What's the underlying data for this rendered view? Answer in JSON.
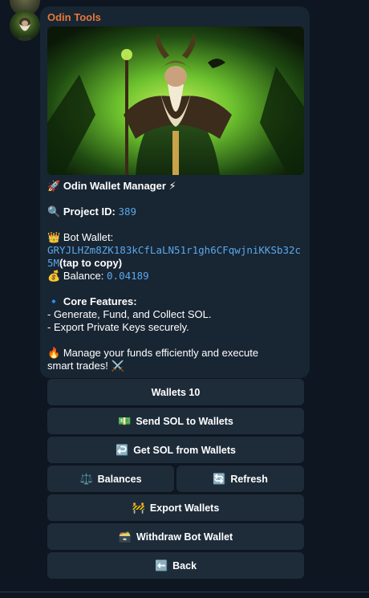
{
  "message": {
    "sender": "Odin Tools",
    "title_emoji": "🚀",
    "title": "Odin Wallet Manager",
    "title_trail_emoji": "⚡",
    "project_emoji": "🔍",
    "project_label": "Project ID:",
    "project_id": "389",
    "wallet_emoji": "👑",
    "wallet_label": "Bot Wallet:",
    "wallet_address": "GRYJLHZm8ZK183kCfLaLN51r1gh6CFqwjniKKSb32c5M",
    "tap_to_copy": "(tap to copy)",
    "balance_emoji": "💰",
    "balance_label": "Balance:",
    "balance_value": "0.04189",
    "features_emoji": "🔹",
    "features_label": "Core Features:",
    "feature_1": "- Generate, Fund, and Collect SOL.",
    "feature_2": "- Export Private Keys securely.",
    "manage_emoji": "🔥",
    "manage_text_1": "Manage your funds efficiently and execute",
    "manage_text_2": "smart trades!",
    "manage_trail_emoji": "⚔️"
  },
  "keyboard": {
    "wallets": {
      "label": "Wallets 10"
    },
    "send": {
      "icon": "💵",
      "label": "Send SOL to Wallets"
    },
    "get": {
      "icon": "↩️",
      "label": "Get SOL from Wallets"
    },
    "balances": {
      "icon": "⚖️",
      "label": "Balances"
    },
    "refresh": {
      "icon": "🔄",
      "label": "Refresh"
    },
    "export": {
      "icon": "🚧",
      "label": "Export Wallets"
    },
    "withdraw": {
      "icon": "🗃️",
      "label": "Withdraw Bot Wallet"
    },
    "back": {
      "icon": "⬅️",
      "label": "Back"
    }
  },
  "colors": {
    "background": "#0e1621",
    "bubble": "#182533",
    "sender": "#e5793a",
    "link": "#5aa8ea",
    "button": "#1e2c3a"
  }
}
